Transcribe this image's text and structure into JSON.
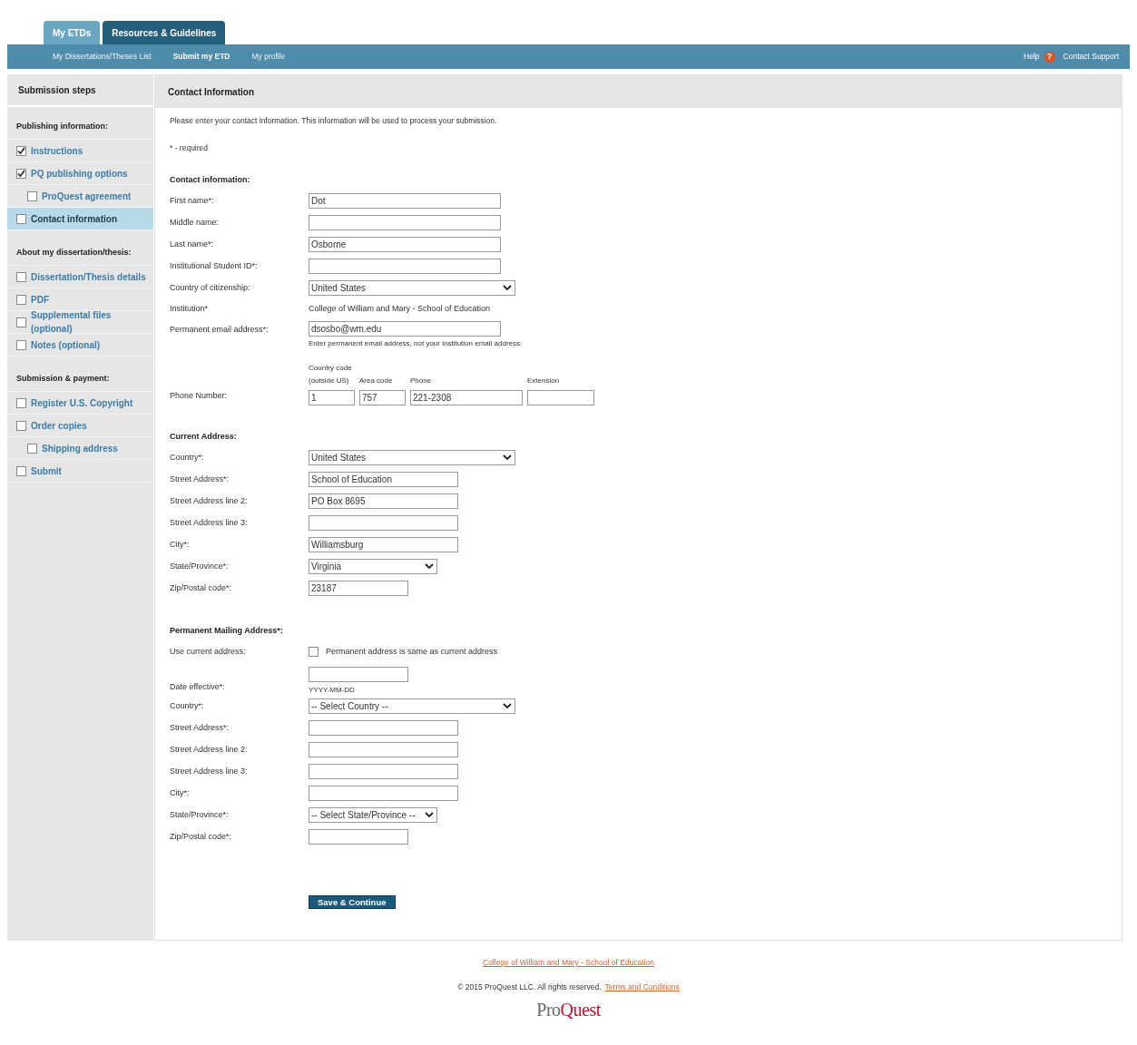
{
  "tabs": [
    {
      "label": "My ETDs",
      "selected": true
    },
    {
      "label": "Resources & Guidelines",
      "selected": false
    }
  ],
  "nav": {
    "links": [
      {
        "label": "My Dissertations/Theses List",
        "selected": false
      },
      {
        "label": "Submit my ETD",
        "selected": true
      },
      {
        "label": "My profile",
        "selected": false
      }
    ],
    "help": "Help",
    "help_icon": "?",
    "support": "Contact Support"
  },
  "sidebar": {
    "title": "Submission steps",
    "groups": [
      {
        "heading": "Publishing information:",
        "items": [
          {
            "label": "Instructions",
            "checked": true,
            "selected": false
          },
          {
            "label": "PQ publishing options",
            "checked": true,
            "selected": false,
            "children": [
              {
                "label": "ProQuest agreement",
                "checked": false,
                "selected": false
              }
            ]
          },
          {
            "label": "Contact information",
            "checked": false,
            "selected": true
          }
        ]
      },
      {
        "heading": "About my dissertation/thesis:",
        "items": [
          {
            "label": "Dissertation/Thesis details",
            "checked": false,
            "selected": false
          },
          {
            "label": "PDF",
            "checked": false,
            "selected": false
          },
          {
            "label": "Supplemental files (optional)",
            "checked": false,
            "selected": false
          },
          {
            "label": "Notes (optional)",
            "checked": false,
            "selected": false
          }
        ]
      },
      {
        "heading": "Submission & payment:",
        "items": [
          {
            "label": "Register U.S. Copyright",
            "checked": false,
            "selected": false
          },
          {
            "label": "Order copies",
            "checked": false,
            "selected": false,
            "children": [
              {
                "label": "Shipping address",
                "checked": false,
                "selected": false
              }
            ]
          },
          {
            "label": "Submit",
            "checked": false,
            "selected": false
          }
        ]
      }
    ]
  },
  "main": {
    "title": "Contact Information",
    "intro": "Please enter your contact information. This information will be used to process your submission.",
    "required_note": "* - required",
    "sections": [
      {
        "heading": "Contact information:",
        "fields": [
          {
            "kind": "text",
            "label": "First name*:",
            "value": "Dot"
          },
          {
            "kind": "text",
            "label": "Middle name:"
          },
          {
            "kind": "text",
            "label": "Last name*:",
            "value": "Osborne"
          },
          {
            "kind": "text",
            "label": "Institutional Student ID*:"
          },
          {
            "kind": "select",
            "label": "Country of citizenship:",
            "value": "United States"
          },
          {
            "kind": "static",
            "label": "Institution*",
            "value": "College of William and Mary - School of Education"
          },
          {
            "kind": "email",
            "label": "Permanent email address*:",
            "value": "dsosbo@wm.edu",
            "note": "Enter permanent email address, not your institution email address."
          },
          {
            "kind": "phone",
            "label": "Phone Number:",
            "parts": [
              {
                "caption": "Country code",
                "caption_2": "(outside US)",
                "value": "1"
              },
              {
                "caption": "Area code",
                "value": "757"
              },
              {
                "caption": "Phone",
                "value": "221-2308"
              },
              {
                "caption": "Extension"
              }
            ]
          }
        ]
      },
      {
        "heading": "Current Address:",
        "fields": [
          {
            "kind": "select",
            "label": "Country*:",
            "value": "United States"
          },
          {
            "kind": "address",
            "label": "Street Address*:",
            "value": "School of Education"
          },
          {
            "kind": "address",
            "label": "Street Address line 2:",
            "value": "PO Box 8695"
          },
          {
            "kind": "address",
            "label": "Street Address line 3:"
          },
          {
            "kind": "address",
            "label": "City*:",
            "value": "Williamsburg"
          },
          {
            "kind": "short_select",
            "label": "State/Province*:",
            "value": "Virginia"
          },
          {
            "kind": "zip",
            "label": "Zip/Postal code*:",
            "value": "23187"
          }
        ]
      },
      {
        "heading": "Permanent Mailing Address*:",
        "fields": [
          {
            "kind": "checkbox",
            "label": "Use current address:",
            "checked": false,
            "text": "Permanent address is same as current address"
          },
          {
            "kind": "date",
            "label": "Date effective*:",
            "hint": "YYYY-MM-DD"
          },
          {
            "kind": "select",
            "label": "Country*:",
            "value": "-- Select Country --"
          },
          {
            "kind": "address",
            "label": "Street Address*:"
          },
          {
            "kind": "address",
            "label": "Street Address line 2:"
          },
          {
            "kind": "address",
            "label": "Street Address line 3:"
          },
          {
            "kind": "address",
            "label": "City*:"
          },
          {
            "kind": "short_select",
            "label": "State/Province*:",
            "value": "-- Select State/Province --"
          },
          {
            "kind": "zip",
            "label": "Zip/Postal code*:"
          }
        ]
      }
    ],
    "submit": "Save & Continue"
  },
  "footer": {
    "institution_link": "College of William and Mary - School of Education",
    "copyright": "© 2015 ProQuest LLC. All rights reserved.",
    "terms_link": "Terms and Conditions",
    "logo": {
      "part_1": "Pro",
      "part_2": "Quest"
    }
  }
}
